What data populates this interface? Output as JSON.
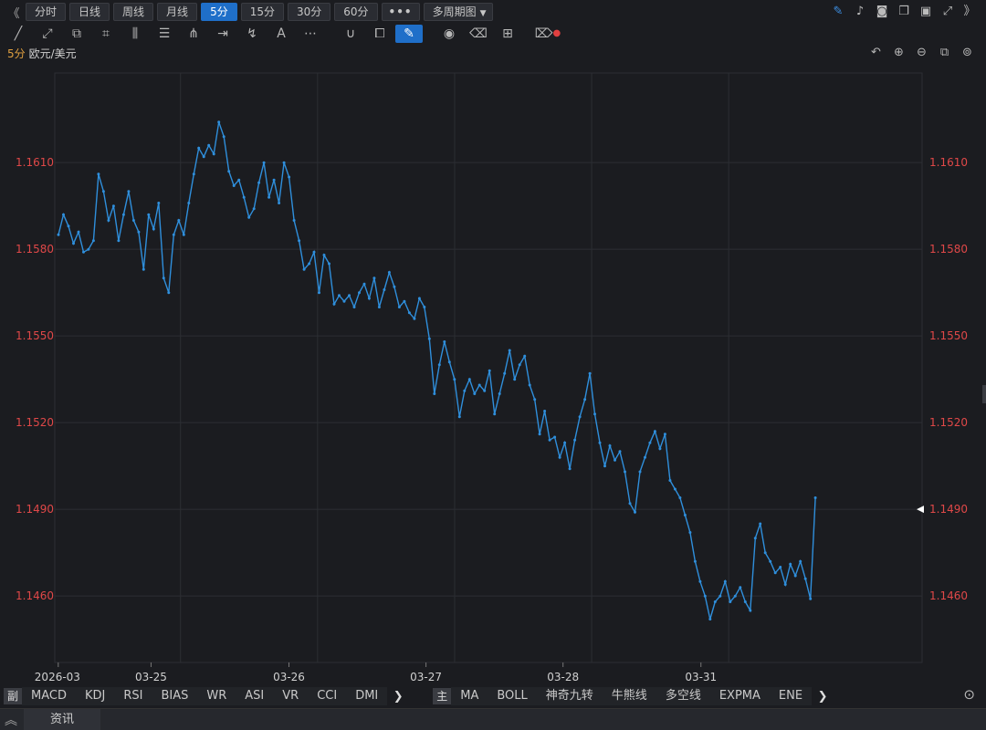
{
  "periods": [
    {
      "label": "分时",
      "active": false
    },
    {
      "label": "日线",
      "active": false
    },
    {
      "label": "周线",
      "active": false
    },
    {
      "label": "月线",
      "active": false
    },
    {
      "label": "5分",
      "active": true
    },
    {
      "label": "15分",
      "active": false
    },
    {
      "label": "30分",
      "active": false
    },
    {
      "label": "60分",
      "active": false
    }
  ],
  "more_label": "•••",
  "multi_period_label": "多周期图",
  "legend": {
    "period": "5分",
    "symbol": "欧元/美元"
  },
  "indicators_sub": {
    "tag": "副",
    "items": [
      "MACD",
      "KDJ",
      "RSI",
      "BIAS",
      "WR",
      "ASI",
      "VR",
      "CCI",
      "DMI"
    ]
  },
  "indicators_main": {
    "tag": "主",
    "items": [
      "MA",
      "BOLL",
      "神奇九转",
      "牛熊线",
      "多空线",
      "EXPMA",
      "ENE"
    ]
  },
  "news_tab": "资讯",
  "colors": {
    "line": "#2f8fdc",
    "price_label": "#e04848",
    "grid": "#2c2e33",
    "axis_text": "#d0d0d0"
  },
  "chart_data": {
    "type": "line",
    "title": "",
    "xlabel": "",
    "ylabel": "",
    "ylim": [
      1.1437,
      1.1641
    ],
    "y_ticks": [
      "1.1460",
      "1.1490",
      "1.1520",
      "1.1550",
      "1.1580",
      "1.1610"
    ],
    "x_tick_labels": [
      "2026-03",
      "03-25",
      "03-26",
      "03-27",
      "03-28",
      "03-31"
    ],
    "last_price": 1.149,
    "grid": true,
    "series": [
      {
        "name": "",
        "x_start": "2026-03-24",
        "x_end": "2026-03-31",
        "values": [
          1.1585,
          1.1592,
          1.1588,
          1.1582,
          1.1586,
          1.1579,
          1.158,
          1.1583,
          1.1606,
          1.16,
          1.159,
          1.1595,
          1.1583,
          1.1592,
          1.16,
          1.159,
          1.1586,
          1.1573,
          1.1592,
          1.1587,
          1.1596,
          1.157,
          1.1565,
          1.1585,
          1.159,
          1.1585,
          1.1596,
          1.1606,
          1.1615,
          1.1612,
          1.1616,
          1.1613,
          1.1624,
          1.1619,
          1.1607,
          1.1602,
          1.1604,
          1.1598,
          1.1591,
          1.1594,
          1.1603,
          1.161,
          1.1598,
          1.1604,
          1.1596,
          1.161,
          1.1605,
          1.159,
          1.1583,
          1.1573,
          1.1575,
          1.1579,
          1.1565,
          1.1578,
          1.1575,
          1.1561,
          1.1564,
          1.1562,
          1.1564,
          1.156,
          1.1565,
          1.1568,
          1.1563,
          1.157,
          1.156,
          1.1566,
          1.1572,
          1.1567,
          1.156,
          1.1562,
          1.1558,
          1.1556,
          1.1563,
          1.156,
          1.1549,
          1.153,
          1.154,
          1.1548,
          1.1541,
          1.1535,
          1.1522,
          1.1531,
          1.1535,
          1.153,
          1.1533,
          1.1531,
          1.1538,
          1.1523,
          1.153,
          1.1537,
          1.1545,
          1.1535,
          1.154,
          1.1543,
          1.1533,
          1.1528,
          1.1516,
          1.1524,
          1.1514,
          1.1515,
          1.1508,
          1.1513,
          1.1504,
          1.1514,
          1.1522,
          1.1528,
          1.1537,
          1.1523,
          1.1513,
          1.1505,
          1.1512,
          1.1507,
          1.151,
          1.1503,
          1.1492,
          1.1489,
          1.1503,
          1.1508,
          1.1513,
          1.1517,
          1.1511,
          1.1516,
          1.15,
          1.1497,
          1.1494,
          1.1488,
          1.1482,
          1.1472,
          1.1465,
          1.146,
          1.1452,
          1.1458,
          1.146,
          1.1465,
          1.1458,
          1.146,
          1.1463,
          1.1458,
          1.1455,
          1.148,
          1.1485,
          1.1475,
          1.1472,
          1.1468,
          1.147,
          1.1464,
          1.1471,
          1.1467,
          1.1472,
          1.1466,
          1.1459,
          1.1494
        ]
      }
    ]
  }
}
